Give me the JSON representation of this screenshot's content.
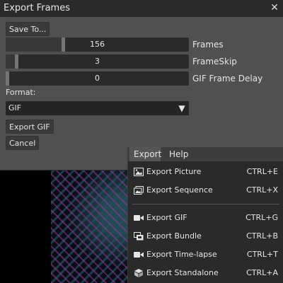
{
  "window": {
    "title": "Export Frames",
    "close_glyph": "✕"
  },
  "buttons": {
    "save_to": "Save To...",
    "export_gif": "Export GIF",
    "cancel": "Cancel"
  },
  "sliders": [
    {
      "value": "156",
      "label": "Frames",
      "level": 0.31
    },
    {
      "value": "3",
      "label": "FrameSkip",
      "level": 0.05
    },
    {
      "value": "0",
      "label": "GIF Frame Delay",
      "level": 0.0
    }
  ],
  "format": {
    "label": "Format:",
    "selected": "GIF",
    "arrow_glyph": "▼"
  },
  "menubar": {
    "export": "Export",
    "help": "Help"
  },
  "menu_items": [
    {
      "label": "Export Picture",
      "shortcut": "CTRL+E",
      "icon": "picture-icon"
    },
    {
      "label": "Export Sequence",
      "shortcut": "CTRL+X",
      "icon": "sequence-icon"
    },
    {
      "label": "Export GIF",
      "shortcut": "CTRL+G",
      "icon": "video-icon"
    },
    {
      "label": "Export Bundle",
      "shortcut": "CTRL+B",
      "icon": "bundle-icon"
    },
    {
      "label": "Export Time-lapse",
      "shortcut": "CTRL+T",
      "icon": "video-icon"
    },
    {
      "label": "Export Standalone",
      "shortcut": "CTRL+A",
      "icon": "cube-icon"
    }
  ]
}
